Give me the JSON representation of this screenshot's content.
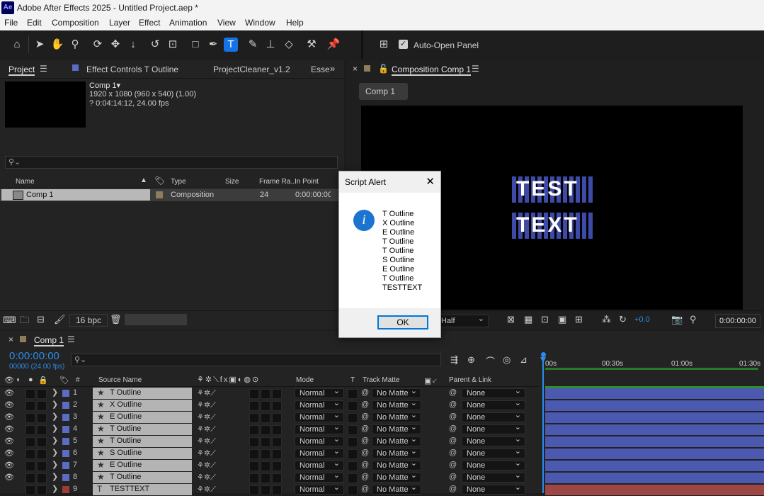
{
  "titlebar": {
    "logo": "Ae",
    "title": "Adobe After Effects 2025 - Untitled Project.aep *"
  },
  "menu": [
    "File",
    "Edit",
    "Composition",
    "Layer",
    "Effect",
    "Animation",
    "View",
    "Window",
    "Help"
  ],
  "toolbar": {
    "auto_open_label": "Auto-Open Panel",
    "auto_open_checked": true,
    "active_tool": "type-tool"
  },
  "project_panel": {
    "tabs": [
      "Project",
      "Effect Controls T Outline",
      "ProjectCleaner_v1.2",
      "Esse"
    ],
    "comp_name": "Comp 1",
    "comp_info1": "1920 x 1080  (960 x 540) (1.00)",
    "comp_info2": "? 0:04:14:12, 24.00 fps",
    "search_placeholder": "",
    "columns": [
      "Name",
      "Type",
      "Size",
      "Frame Ra...",
      "In Point"
    ],
    "item": {
      "name": "Comp 1",
      "type": "Composition",
      "frame_rate": "24",
      "in_point": "0:00:00:00"
    },
    "bpc": "16 bpc"
  },
  "composition_panel": {
    "tab": "Composition  Comp 1",
    "breadcrumb": "Comp 1",
    "resolution": "Half",
    "exposure": "+0.0",
    "timecode": "0:00:00:00",
    "text_line1": "TEST",
    "text_line2": "TEXT"
  },
  "dialog": {
    "title": "Script Alert",
    "lines": [
      "T Outline",
      "X Outline",
      "E Outline",
      "T Outline",
      "T Outline",
      "S Outline",
      "E Outline",
      "T Outline",
      "TESTTEXT"
    ],
    "ok": "OK"
  },
  "timeline": {
    "tab": "Comp 1",
    "timecode": "0:00:00:00",
    "frames": "00000 (24.00 fps)",
    "columns": {
      "hash": "#",
      "source": "Source Name",
      "mode": "Mode",
      "t": "T",
      "track_matte": "Track Matte",
      "parent": "Parent & Link"
    },
    "ruler": [
      "00s",
      "00:30s",
      "01:00s",
      "01:30s"
    ],
    "layers": [
      {
        "num": "1",
        "name": "T Outline",
        "mode": "Normal",
        "matte": "No Matte",
        "parent": "None",
        "type": "star"
      },
      {
        "num": "2",
        "name": "X Outline",
        "mode": "Normal",
        "matte": "No Matte",
        "parent": "None",
        "type": "star"
      },
      {
        "num": "3",
        "name": "E Outline",
        "mode": "Normal",
        "matte": "No Matte",
        "parent": "None",
        "type": "star"
      },
      {
        "num": "4",
        "name": "T Outline",
        "mode": "Normal",
        "matte": "No Matte",
        "parent": "None",
        "type": "star"
      },
      {
        "num": "5",
        "name": "T Outline",
        "mode": "Normal",
        "matte": "No Matte",
        "parent": "None",
        "type": "star"
      },
      {
        "num": "6",
        "name": "S Outline",
        "mode": "Normal",
        "matte": "No Matte",
        "parent": "None",
        "type": "star"
      },
      {
        "num": "7",
        "name": "E Outline",
        "mode": "Normal",
        "matte": "No Matte",
        "parent": "None",
        "type": "star"
      },
      {
        "num": "8",
        "name": "T Outline",
        "mode": "Normal",
        "matte": "No Matte",
        "parent": "None",
        "type": "star"
      },
      {
        "num": "9",
        "name": "TESTTEXT",
        "mode": "Normal",
        "matte": "No Matte",
        "parent": "None",
        "type": "text"
      }
    ]
  },
  "colors": {
    "accent": "#1473e6",
    "shape_label": "#5a6cc4",
    "text_label": "#a33a3a",
    "bar_shape": "#4b59b0",
    "bar_text": "#9c4646",
    "timecode": "#2d8ceb"
  }
}
